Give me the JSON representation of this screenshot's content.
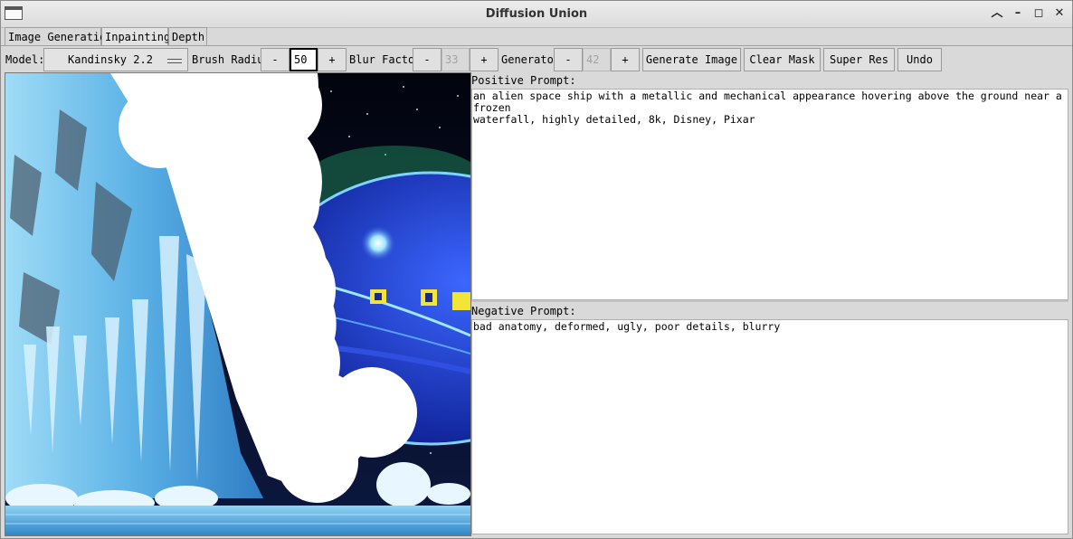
{
  "window": {
    "title": "Diffusion Union"
  },
  "tabs": [
    {
      "label": "Image Generation"
    },
    {
      "label": "Inpainting",
      "selected": true
    },
    {
      "label": "Depth"
    }
  ],
  "toolbar": {
    "model_label": "Model:",
    "model_value": "Kandinsky 2.2",
    "brush_label": "Brush Radius",
    "brush_value": "50",
    "blur_label": "Blur Factor",
    "blur_value": "33",
    "generator_label": "Generator",
    "generator_value": "42",
    "minus": "-",
    "plus": "+",
    "generate_label": "Generate Image",
    "clear_mask_label": "Clear Mask",
    "super_res_label": "Super Res",
    "undo_label": "Undo"
  },
  "prompts": {
    "positive_label": "Positive Prompt:",
    "positive_text": "an alien space ship with a metallic and mechanical appearance hovering above the ground near a frozen\nwaterfall, highly detailed, 8k, Disney, Pixar",
    "negative_label": "Negative Prompt:",
    "negative_text": "bad anatomy, deformed, ugly, poor details, blurry"
  },
  "colors": {
    "ice": "#7ec8ee",
    "ship": "#1c3fd6",
    "space": "#0a0f24",
    "mask": "#ffffff"
  },
  "icons": [
    "window-icon",
    "chevron-up-icon",
    "minimize-icon",
    "maximize-icon",
    "close-icon",
    "dropdown-grip-icon"
  ]
}
